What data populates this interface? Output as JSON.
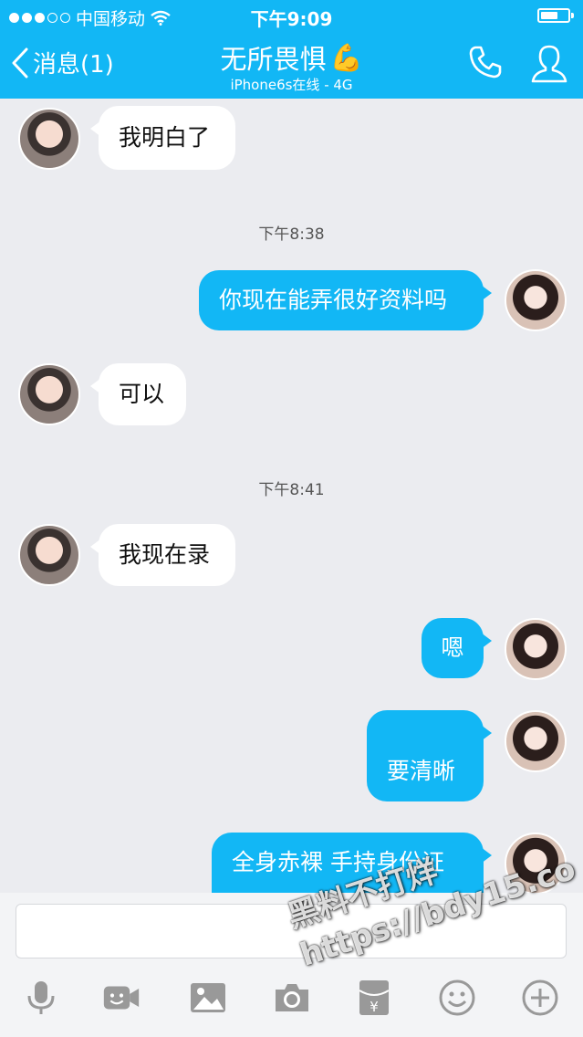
{
  "status_bar": {
    "carrier": "中国移动",
    "time": "下午9:09",
    "battery_percent": 70
  },
  "header": {
    "back_label": "消息(1)",
    "title": "无所畏惧",
    "title_emoji": "💪",
    "subtitle": "iPhone6s在线 - 4G",
    "icons": [
      "phone-icon",
      "profile-icon"
    ]
  },
  "messages": [
    {
      "side": "left",
      "text": "我明白了"
    },
    {
      "time": "下午8:38"
    },
    {
      "side": "right",
      "text": "你现在能弄很好资料吗"
    },
    {
      "side": "left",
      "text": "可以"
    },
    {
      "time": "下午8:41"
    },
    {
      "side": "left",
      "text": "我现在录"
    },
    {
      "side": "right",
      "text": "嗯"
    },
    {
      "side": "right",
      "text": "要清晰"
    },
    {
      "side": "right",
      "text": "全身赤裸 手持身份证"
    }
  ],
  "input": {
    "value": "",
    "toolbar": [
      "microphone-icon",
      "video-icon",
      "image-icon",
      "camera-icon",
      "red-packet-icon",
      "emoji-icon",
      "plus-icon"
    ]
  },
  "watermark": {
    "line1": "黑料不打烊",
    "line2": "https://bdy15.co"
  },
  "colors": {
    "accent": "#12b7f5",
    "background": "#ebecf0",
    "bubble_left": "#ffffff"
  }
}
